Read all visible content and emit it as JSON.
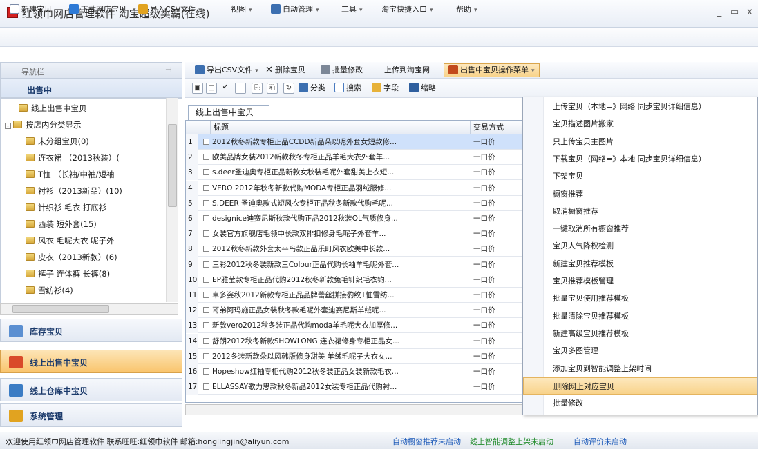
{
  "window": {
    "app_icon_text": "网",
    "title": "红领巾网店管理软件  淘宝超级卖霸(在线)",
    "minimize": "_",
    "maximize": "▭",
    "close": "x"
  },
  "menubar": {
    "new_item": "新建宝贝",
    "download_item": "下载网店宝贝",
    "import_csv": "导入CSV文件",
    "view": "视图",
    "auto_manage": "自动管理",
    "tools": "工具",
    "taobao_entry": "淘宝快捷入口",
    "help": "帮助"
  },
  "sidebar": {
    "nav_label": "导航栏",
    "section_title": "出售中",
    "tree": [
      {
        "label": "线上出售中宝贝",
        "level": 0
      },
      {
        "label": "按店内分类显示",
        "level": 0,
        "expander": "-"
      },
      {
        "label": "未分组宝贝(0)",
        "level": 1
      },
      {
        "label": "连衣裙 （2013秋装）(",
        "level": 1
      },
      {
        "label": "T恤 （长袖/中袖/短袖",
        "level": 1
      },
      {
        "label": "衬衫（2013新品）(10)",
        "level": 1
      },
      {
        "label": "针织衫  毛衣  打底衫",
        "level": 1
      },
      {
        "label": "西装  短外套(15)",
        "level": 1
      },
      {
        "label": "风衣  毛呢大衣 呢子外",
        "level": 1
      },
      {
        "label": "皮衣（2013新款）(6)",
        "level": 1
      },
      {
        "label": "裤子  连体裤  长裤(8)",
        "level": 1
      },
      {
        "label": "雪纺衫(4)",
        "level": 1
      }
    ],
    "sections": [
      {
        "label": "库存宝贝",
        "active": false,
        "color": "#5b8fd1"
      },
      {
        "label": "线上出售中宝贝",
        "active": true,
        "color": "#d94a2a"
      },
      {
        "label": "线上仓库中宝贝",
        "active": false,
        "color": "#3b7cc4"
      },
      {
        "label": "系统管理",
        "active": false,
        "color": "#e1a320"
      }
    ]
  },
  "toolbar2": {
    "export_csv": "导出CSV文件",
    "delete": "删除宝贝",
    "batch_edit": "批量修改",
    "upload": "上传到淘宝网",
    "sale_menu": "出售中宝贝操作菜单"
  },
  "toolbar3": {
    "category": "分类",
    "search": "搜索",
    "fields": "字段",
    "thumb": "缩略"
  },
  "grid": {
    "tab": "线上出售中宝贝",
    "col_title": "标题",
    "col_trade": "交易方式",
    "rows": [
      {
        "n": "1",
        "title": "2012秋冬新款专柜正品CCDD新品朵以呢外套女短款修...",
        "trade": "一口价",
        "sel": true
      },
      {
        "n": "2",
        "title": "欧美品牌女装2012新款秋冬专柜正品羊毛大衣外套羊...",
        "trade": "一口价"
      },
      {
        "n": "3",
        "title": "s.deer圣迪奥专柜正品新款女秋装毛呢外套甜美上衣短...",
        "trade": "一口价"
      },
      {
        "n": "4",
        "title": "VERO 2012年秋冬新款代购MODA专柜正品羽绒服修...",
        "trade": "一口价"
      },
      {
        "n": "5",
        "title": "S.DEER 圣迪奥款式短风衣专柜正品秋冬新款代购毛呢...",
        "trade": "一口价"
      },
      {
        "n": "6",
        "title": "designice迪赛尼斯秋款代购正品2012秋装OL气质修身...",
        "trade": "一口价"
      },
      {
        "n": "7",
        "title": "女装官方旗舰店毛领中长款双排扣修身毛呢子外套羊...",
        "trade": "一口价"
      },
      {
        "n": "8",
        "title": "2012秋冬新款外套太平鸟款正品乐町风衣欧美中长款...",
        "trade": "一口价"
      },
      {
        "n": "9",
        "title": "三彩2012秋冬装新款三Colour正品代购长袖羊毛呢外套...",
        "trade": "一口价"
      },
      {
        "n": "10",
        "title": "EP雅莹款专柜正品代购2012秋冬新款兔毛针织毛衣钧...",
        "trade": "一口价"
      },
      {
        "n": "11",
        "title": "卓多姿秋2012新款专柜正品品牌蕾丝拼接豹纹T恤雪纺...",
        "trade": "一口价"
      },
      {
        "n": "12",
        "title": "哥弟阿玛施正品女装秋冬款毛呢外套迪赛尼斯羊绒呢...",
        "trade": "一口价"
      },
      {
        "n": "13",
        "title": "新款vero2012秋冬装正品代购moda羊毛呢大衣加厚修...",
        "trade": "一口价"
      },
      {
        "n": "14",
        "title": "舒朗2012秋冬新款SHOWLONG 连衣裙修身专柜正品女...",
        "trade": "一口价"
      },
      {
        "n": "15",
        "title": "2012冬装新款朵以风韩版修身甜美 羊绒毛呢子大衣女...",
        "trade": "一口价"
      },
      {
        "n": "16",
        "title": "Hopeshow红袖专柜代购2012秋冬装正品女装新款毛衣...",
        "trade": "一口价"
      },
      {
        "n": "17",
        "title": "ELLASSAY歌力思款秋冬新品2012女装专柜正品代购衬...",
        "trade": "一口价"
      }
    ]
  },
  "dropdown": [
    "上传宝贝（本地=》网络 同步宝贝详细信息）",
    "宝贝描述图片搬家",
    "只上传宝贝主图片",
    "下载宝贝（网络=》本地 同步宝贝详细信息）",
    "下架宝贝",
    "橱窗推荐",
    "取消橱窗推荐",
    "一键取消所有橱窗推荐",
    "宝贝人气降权检测",
    "新建宝贝推荐模板",
    "宝贝推荐模板管理",
    "批量宝贝使用推荐模板",
    "批量清除宝贝推荐模板",
    "新建高级宝贝推荐模板",
    "宝贝多图管理",
    "添加宝贝到智能调整上架时间",
    "删除网上对应宝贝",
    "批量修改"
  ],
  "dropdown_highlight_index": 16,
  "status": {
    "welcome": "欢迎使用红领巾网店管理软件  联系旺旺:红领巾软件 邮箱:honglingjin@aliyun.com",
    "window_status": "自动橱窗推荐未启动",
    "shelf_status": "线上智能调整上架未启动",
    "review_status": "自动评价未启动"
  },
  "colors": {
    "accent": "#f8d38b",
    "selection": "#cfe1fb",
    "status_blue": "#1a58b8",
    "status_green": "#1f8a2a"
  }
}
